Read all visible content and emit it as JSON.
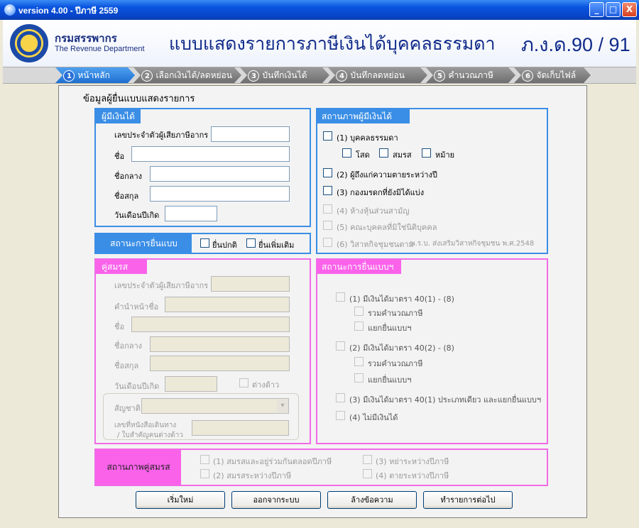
{
  "window": {
    "title": "version 4.00 - ปีภาษี 2559",
    "buttons": [
      "_",
      "□",
      "X"
    ]
  },
  "header": {
    "dept_th": "กรมสรรพากร",
    "dept_en": "The Revenue Department",
    "form_title": "แบบแสดงรายการภาษีเงินได้บุคคลธรรมดา",
    "form_code": "ภ.ง.ด.90 / 91"
  },
  "steps": [
    {
      "num": "1",
      "label": "หน้าหลัก"
    },
    {
      "num": "2",
      "label": "เลือกเงินได้/ลดหย่อน"
    },
    {
      "num": "3",
      "label": "บันทึกเงินได้"
    },
    {
      "num": "4",
      "label": "บันทึกลดหย่อน"
    },
    {
      "num": "5",
      "label": "คำนวณภาษี"
    },
    {
      "num": "6",
      "label": "จัดเก็บไฟล์"
    }
  ],
  "section_title": "ข้อมูลผู้ยื่นแบบแสดงรายการ",
  "earner": {
    "title": "ผู้มีเงินได้",
    "tax_id": "เลขประจำตัวผู้เสียภาษีอากร",
    "first_name": "ชื่อ",
    "middle_name": "ชื่อกลาง",
    "last_name": "ชื่อสกุล",
    "birth_date": "วันเดือนปีเกิด"
  },
  "filing_status": {
    "title": "สถานะการยื่นแบบ",
    "normal": "ยื่นปกติ",
    "additional": "ยื่นเพิ่มเติม"
  },
  "earner_status": {
    "title": "สถานภาพผู้มีเงินได้",
    "opt1": "(1) บุคคลธรรมดา",
    "single": "โสด",
    "married": "สมรส",
    "widowed": "หม้าย",
    "opt2": "(2) ผู้ถึงแก่ความตายระหว่างปี",
    "opt3": "(3) กองมรดกที่ยังมิได้แบ่ง",
    "opt4": "(4) ห้างหุ้นส่วนสามัญ",
    "opt5": "(5) คณะบุคคลที่มิใช่นิติบุคคล",
    "opt6": "(6) วิสาหกิจชุมชนตาม",
    "opt6_note": "พ.ร.บ. ส่งเสริมวิสาหกิจชุมชน พ.ศ.2548"
  },
  "spouse": {
    "title": "คู่สมรส",
    "tax_id": "เลขประจำตัวผู้เสียภาษีอากร",
    "prefix": "คำนำหน้าชื่อ",
    "first_name": "ชื่อ",
    "middle_name": "ชื่อกลาง",
    "last_name": "ชื่อสกุล",
    "birth_date": "วันเดือนปีเกิด",
    "foreigner": "ต่างด้าว",
    "nationality": "สัญชาติ",
    "passport_line1": "เลขที่หนังสือเดินทาง",
    "passport_line2": "/ ใบสำคัญคนต่างด้าว"
  },
  "filing_status2": {
    "title": "สถานะการยื่นแบบฯ",
    "opt1": "(1) มีเงินได้มาตรา 40(1) - (8)",
    "opt1_a": "รวมคำนวณภาษี",
    "opt1_b": "แยกยื่นแบบฯ",
    "opt2": "(2) มีเงินได้มาตรา 40(2) - (8)",
    "opt2_a": "รวมคำนวณภาษี",
    "opt2_b": "แยกยื่นแบบฯ",
    "opt3": "(3) มีเงินได้มาตรา 40(1) ประเภทเดียว และแยกยื่นแบบฯ",
    "opt4": "(4) ไม่มีเงินได้"
  },
  "spouse_status": {
    "title": "สถานภาพคู่สมรส",
    "opt1": "(1) สมรสและอยู่ร่วมกันตลอดปีภาษี",
    "opt2": "(2) สมรสระหว่างปีภาษี",
    "opt3": "(3) หย่าระหว่างปีภาษี",
    "opt4": "(4) ตายระหว่างปีภาษี"
  },
  "buttons": {
    "restart": "เริ่มใหม่",
    "exit": "ออกจากระบบ",
    "clear": "ล้างข้อความ",
    "next": "ทำรายการต่อไป"
  },
  "colors": {
    "blue": "#3a8ee6",
    "pink": "#fa62ea",
    "titlebar": "#0a55e0"
  }
}
